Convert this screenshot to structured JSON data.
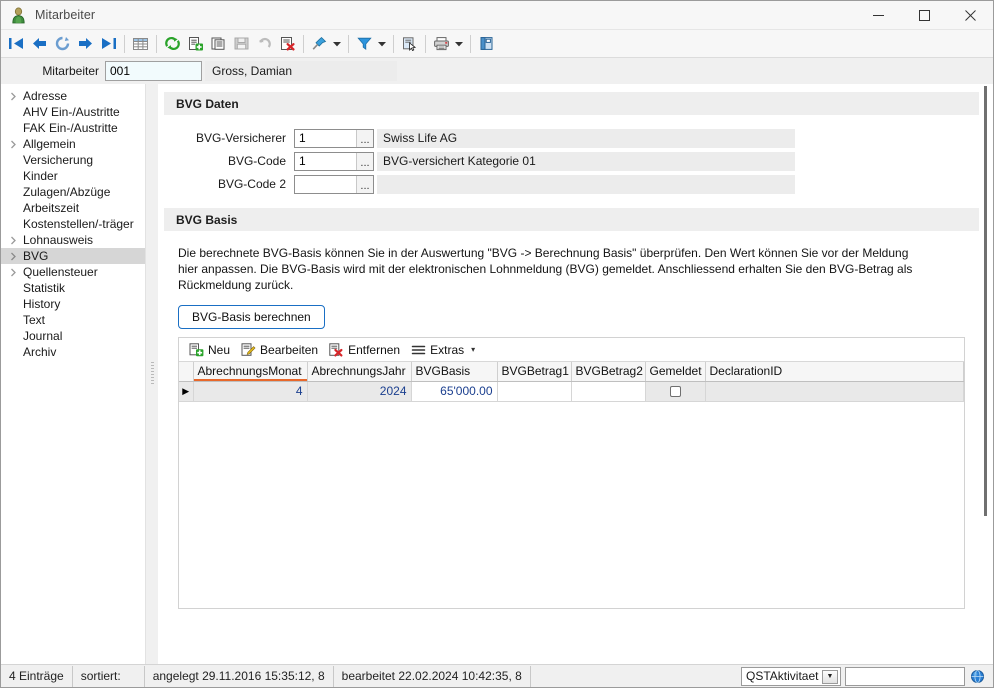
{
  "window": {
    "title": "Mitarbeiter",
    "icon": "person-icon",
    "minimize_label": "—",
    "maximize_label": "☐",
    "close_label": "✕"
  },
  "toolbar": {
    "items": [
      {
        "name": "first-record-icon",
        "type": "icon"
      },
      {
        "name": "previous-record-icon",
        "type": "icon"
      },
      {
        "name": "refresh-record-icon",
        "type": "icon"
      },
      {
        "name": "next-record-icon",
        "type": "icon"
      },
      {
        "name": "last-record-icon",
        "type": "icon"
      },
      {
        "name": "separator-1",
        "type": "sep"
      },
      {
        "name": "table-view-icon",
        "type": "icon"
      },
      {
        "name": "separator-2",
        "type": "sep"
      },
      {
        "name": "refresh-icon",
        "type": "icon"
      },
      {
        "name": "new-record-icon",
        "type": "icon"
      },
      {
        "name": "copy-record-icon",
        "type": "icon"
      },
      {
        "name": "save-icon",
        "type": "icon"
      },
      {
        "name": "undo-icon",
        "type": "icon"
      },
      {
        "name": "delete-record-icon",
        "type": "icon"
      },
      {
        "name": "separator-3",
        "type": "sep"
      },
      {
        "name": "pin-icon",
        "type": "icon"
      },
      {
        "name": "pin-dropdown-arrow",
        "type": "arrow"
      },
      {
        "name": "separator-4",
        "type": "sep"
      },
      {
        "name": "filter-icon",
        "type": "icon"
      },
      {
        "name": "filter-dropdown-arrow",
        "type": "arrow"
      },
      {
        "name": "separator-5",
        "type": "sep"
      },
      {
        "name": "select-icon",
        "type": "icon"
      },
      {
        "name": "separator-6",
        "type": "sep"
      },
      {
        "name": "print-icon",
        "type": "icon"
      },
      {
        "name": "print-dropdown-arrow",
        "type": "arrow"
      },
      {
        "name": "separator-7",
        "type": "sep"
      },
      {
        "name": "export-icon",
        "type": "icon"
      }
    ]
  },
  "record": {
    "label": "Mitarbeiter",
    "number": "001",
    "name": "Gross, Damian"
  },
  "sidebar": {
    "items": [
      {
        "label": "Adresse",
        "expandable": true,
        "selected": false
      },
      {
        "label": "AHV Ein-/Austritte",
        "expandable": false,
        "selected": false
      },
      {
        "label": "FAK Ein-/Austritte",
        "expandable": false,
        "selected": false
      },
      {
        "label": "Allgemein",
        "expandable": true,
        "selected": false
      },
      {
        "label": "Versicherung",
        "expandable": false,
        "selected": false
      },
      {
        "label": "Kinder",
        "expandable": false,
        "selected": false
      },
      {
        "label": "Zulagen/Abzüge",
        "expandable": false,
        "selected": false
      },
      {
        "label": "Arbeitszeit",
        "expandable": false,
        "selected": false
      },
      {
        "label": "Kostenstellen/-träger",
        "expandable": false,
        "selected": false
      },
      {
        "label": "Lohnausweis",
        "expandable": true,
        "selected": false
      },
      {
        "label": "BVG",
        "expandable": true,
        "selected": true
      },
      {
        "label": "Quellensteuer",
        "expandable": true,
        "selected": false
      },
      {
        "label": "Statistik",
        "expandable": false,
        "selected": false
      },
      {
        "label": "History",
        "expandable": false,
        "selected": false
      },
      {
        "label": "Text",
        "expandable": false,
        "selected": false
      },
      {
        "label": "Journal",
        "expandable": false,
        "selected": false
      },
      {
        "label": "Archiv",
        "expandable": false,
        "selected": false
      }
    ]
  },
  "bvg_daten": {
    "title": "BVG Daten",
    "ellipsis_label": "...",
    "fields": [
      {
        "label": "BVG-Versicherer",
        "value": "1",
        "description": "Swiss Life AG"
      },
      {
        "label": "BVG-Code",
        "value": "1",
        "description": "BVG-versichert Kategorie 01"
      },
      {
        "label": "BVG-Code 2",
        "value": "",
        "description": ""
      }
    ]
  },
  "bvg_basis": {
    "title": "BVG Basis",
    "description": "Die berechnete BVG-Basis können Sie in der Auswertung \"BVG -> Berechnung Basis\" überprüfen. Den Wert können Sie vor der Meldung hier anpassen. Die BVG-Basis wird mit der elektronischen Lohnmeldung (BVG) gemeldet. Anschliessend erhalten Sie den BVG-Betrag als Rückmeldung zurück.",
    "calc_button": "BVG-Basis berechnen",
    "grid_toolbar": {
      "new": "Neu",
      "edit": "Bearbeiten",
      "remove": "Entfernen",
      "extras": "Extras",
      "extras_caret": "▾"
    },
    "grid": {
      "columns": [
        "AbrechnungsMonat",
        "AbrechnungsJahr",
        "BVGBasis",
        "BVGBetrag1",
        "BVGBetrag2",
        "Gemeldet",
        "DeclarationID"
      ],
      "sorted_column": "AbrechnungsMonat",
      "rows": [
        {
          "marker": "▶",
          "AbrechnungsMonat": "4",
          "AbrechnungsJahr": "2024",
          "BVGBasis": "65'000.00",
          "BVGBetrag1": "",
          "BVGBetrag2": "",
          "Gemeldet": false,
          "DeclarationID": ""
        }
      ]
    }
  },
  "statusbar": {
    "entries": "4 Einträge",
    "sorted": "sortiert:",
    "created": "angelegt 29.11.2016 15:35:12,  8",
    "modified": "bearbeitet 22.02.2024 10:42:35,  8",
    "select_value": "QSTAktivitaet",
    "select_caret": "▼",
    "field_value": "",
    "globe_icon": "globe-icon"
  },
  "colors": {
    "accent": "#1a6fc4",
    "sort_marker": "#e8682b",
    "grid_value_text": "#1b3f8f",
    "selected_row": "#e9e9e9"
  }
}
